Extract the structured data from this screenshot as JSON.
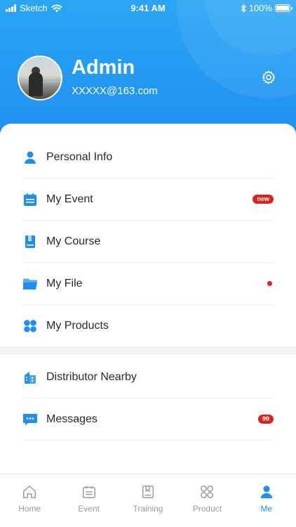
{
  "status_bar": {
    "carrier": "Sketch",
    "time": "9:41 AM",
    "battery": "100%"
  },
  "profile": {
    "name": "Admin",
    "email": "XXXXX@163.com"
  },
  "menu_group_1": [
    {
      "label": "Personal Info",
      "icon": "person-icon"
    },
    {
      "label": "My Event",
      "icon": "calendar-icon",
      "badge": "new"
    },
    {
      "label": "My Course",
      "icon": "book-icon"
    },
    {
      "label": "My File",
      "icon": "folder-icon",
      "dot": true
    },
    {
      "label": "My Products",
      "icon": "products-icon"
    }
  ],
  "menu_group_2": [
    {
      "label": "Distributor Nearby",
      "icon": "building-icon"
    },
    {
      "label": "Messages",
      "icon": "message-icon",
      "badge": "99"
    }
  ],
  "tabs": [
    {
      "label": "Home",
      "icon": "home-icon"
    },
    {
      "label": "Event",
      "icon": "calendar-icon"
    },
    {
      "label": "Training",
      "icon": "book-icon"
    },
    {
      "label": "Product",
      "icon": "products-icon"
    },
    {
      "label": "Me",
      "icon": "person-icon",
      "active": true
    }
  ],
  "colors": {
    "accent": "#1e8ff0",
    "header_top": "#2aa6f5",
    "badge": "#e02020",
    "tab_inactive": "#9a9a9a"
  }
}
